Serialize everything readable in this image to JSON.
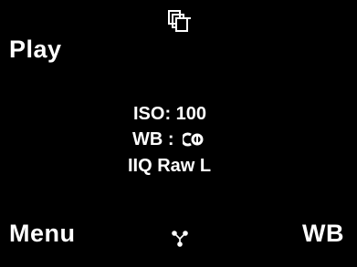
{
  "softkeys": {
    "top_left": "Play",
    "bottom_left": "Menu",
    "bottom_right": "WB"
  },
  "icons": {
    "top_center": "multi-image-stack-icon",
    "white_balance": "auto-white-balance-icon",
    "bottom_center": "network-connection-icon"
  },
  "info": {
    "iso": "ISO: 100",
    "wb_label": "WB : ",
    "format": "IIQ Raw L"
  },
  "colors": {
    "background": "#000000",
    "text": "#ffffff"
  }
}
